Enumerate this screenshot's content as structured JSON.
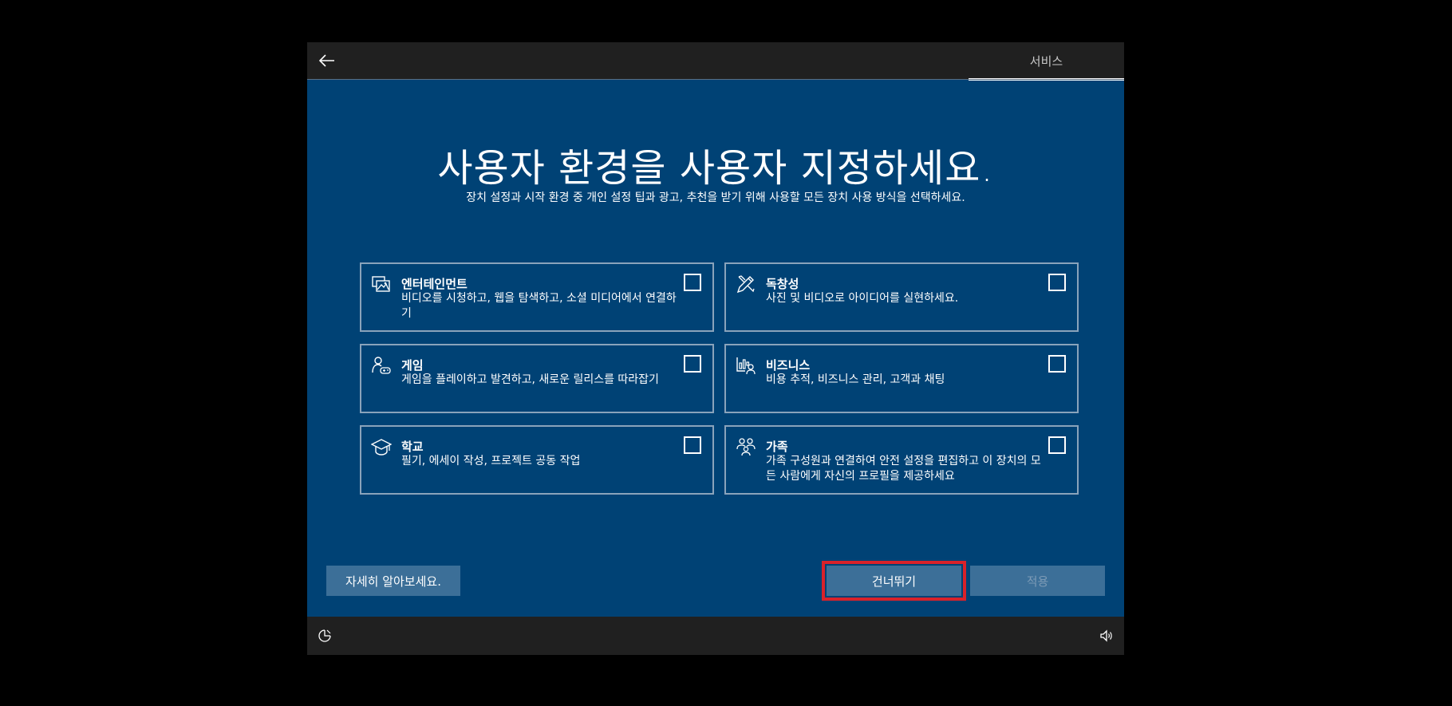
{
  "header": {
    "tab_label": "서비스"
  },
  "main": {
    "title": "사용자 환경을 사용자 지정하세요.",
    "subtitle": "장치 설정과 시작 환경 중 개인 설정 팁과 광고, 추천을 받기 위해 사용할 모든 장치 사용 방식을 선택하세요."
  },
  "options": [
    {
      "title": "엔터테인먼트",
      "description": "비디오를 시청하고, 웹을 탐색하고, 소셜 미디어에서 연결하기",
      "icon": "entertainment-icon",
      "checked": false
    },
    {
      "title": "독창성",
      "description": "사진 및 비디오로 아이디어를 실현하세요.",
      "icon": "creativity-icon",
      "checked": false
    },
    {
      "title": "게임",
      "description": "게임을 플레이하고 발견하고, 새로운 릴리스를 따라잡기",
      "icon": "gaming-icon",
      "checked": false
    },
    {
      "title": "비즈니스",
      "description": "비용 추적, 비즈니스 관리, 고객과 채팅",
      "icon": "business-icon",
      "checked": false
    },
    {
      "title": "학교",
      "description": "필기, 에세이 작성, 프로젝트 공동 작업",
      "icon": "school-icon",
      "checked": false
    },
    {
      "title": "가족",
      "description": "가족 구성원과 연결하여 안전 설정을 편집하고 이 장치의 모든 사람에게 자신의 프로필을 제공하세요",
      "icon": "family-icon",
      "checked": false
    }
  ],
  "footer": {
    "learn_more_label": "자세히 알아보세요.",
    "skip_label": "건너뛰기",
    "apply_label": "적용"
  },
  "colors": {
    "background": "#004275",
    "bar": "#202020",
    "button": "#3c6f98",
    "highlight": "#d9222a"
  }
}
